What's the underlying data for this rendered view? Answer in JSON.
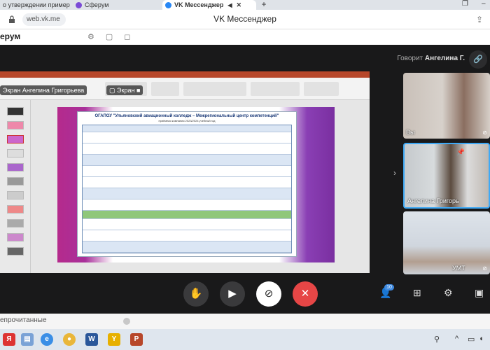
{
  "browser": {
    "tabs": [
      {
        "label": "о утверждении пример",
        "active": false
      },
      {
        "label": "Сферум",
        "active": false
      },
      {
        "label": "VK Мессенджер",
        "active": true
      }
    ],
    "new_tab": "+",
    "url": "web.vk.me",
    "page_title": "VK Мессенджер"
  },
  "vk": {
    "logo_fragment": "ерум"
  },
  "call": {
    "speaking_prefix": "Говорит",
    "speaking_name": "Ангелина Г.",
    "screen_label": "Экран Ангелина Григорьева",
    "screen_label2": "Экран",
    "slide": {
      "title": "ОГАПОУ \"Ульяновский авиационный колледж – Межрегиональный центр компетенций\"",
      "subtitle": "приёмная компания 2023/2024 учебный год"
    },
    "participants": [
      {
        "label": "Вы",
        "muted": true
      },
      {
        "label": "Ангелина Григорь",
        "muted": false
      },
      {
        "label": "УМТ",
        "muted": true
      }
    ],
    "controls": {
      "hand": "raise-hand",
      "camera": "camera",
      "mic": "mic-off",
      "end": "end-call"
    },
    "participants_badge": "10"
  },
  "list": {
    "unread_label": "епрочитанные"
  },
  "colors": {
    "end_call": "#e64646",
    "active_tile_border": "#3fa9f5",
    "powerpoint": "#b7472a"
  }
}
